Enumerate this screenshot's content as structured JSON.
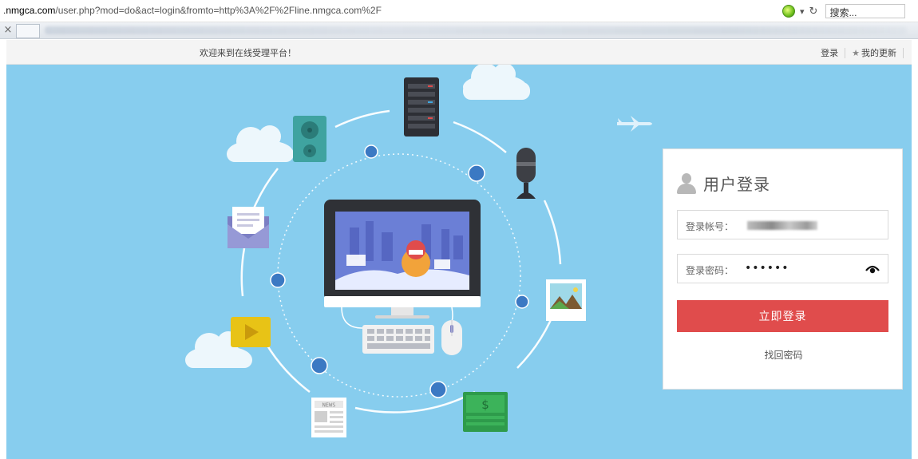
{
  "browser": {
    "url_domain": "nmgca.com",
    "url_prefix": ".",
    "url_path": "/user.php?mod=do&act=login&fromto=http%3A%2F%2Fline.nmgca.com%2F",
    "search_placeholder": "搜索...",
    "tab_close_glyph": "×",
    "icons": [
      "ie-icon",
      "dropdown-icon",
      "refresh-icon"
    ]
  },
  "topbar": {
    "welcome": "欢迎来到在线受理平台！",
    "login_link": "登录",
    "updates_link": "我的更新",
    "star_glyph": "★"
  },
  "hero": {
    "background": "#87cdee",
    "monitor_screen_bg": "#6b7fd6",
    "banner_text": "NEWS",
    "money_glyph": "$",
    "icons": [
      "server-icon",
      "speaker-icon",
      "microphone-icon",
      "mail-icon",
      "computer-icon",
      "keyboard-icon",
      "mouse-icon",
      "picture-icon",
      "video-icon",
      "newspaper-icon",
      "money-icon",
      "cloud-icon",
      "airplane-icon"
    ]
  },
  "login": {
    "title": "用户登录",
    "account_label": "登录帐号：",
    "password_label": "登录密码：",
    "password_mask": "••••••",
    "submit": "立即登录",
    "forgot": "找回密码",
    "accent": "#e04c4c"
  }
}
